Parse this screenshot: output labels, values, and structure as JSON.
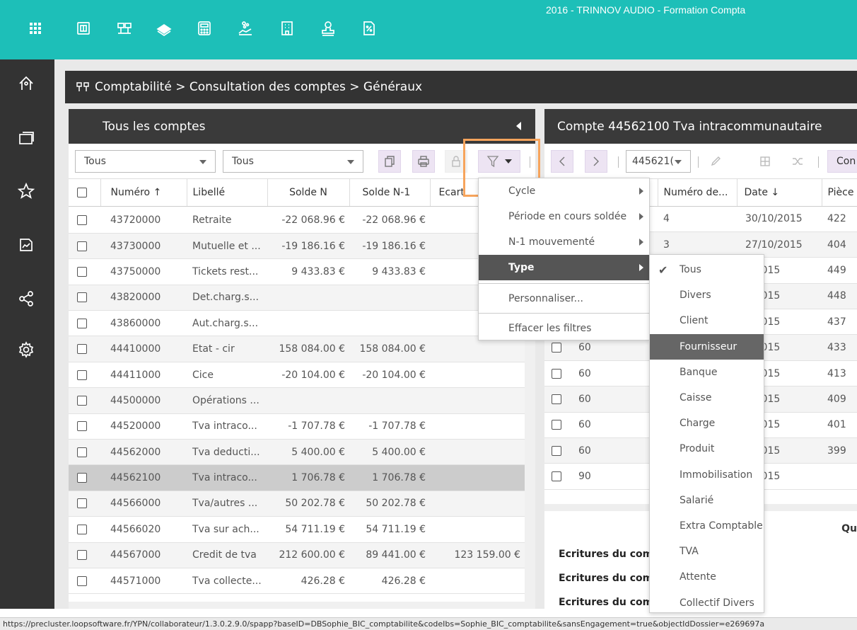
{
  "app": {
    "title": "2016 - TRINNOV AUDIO - Formation Compta"
  },
  "topbar_icons": [
    "apps-grid-icon",
    "dossier-icon",
    "accounting-icon",
    "banknotes-icon",
    "calculator-icon",
    "payroll-icon",
    "building-icon",
    "user-stamp-icon",
    "percent-document-icon"
  ],
  "leftnav_icons": [
    "home-icon",
    "screens-icon",
    "star-icon",
    "chart-document-icon",
    "share-icon",
    "settings-icon"
  ],
  "breadcrumb": "Comptabilité > Consultation des comptes > Généraux",
  "left_panel": {
    "title": "Tous les comptes",
    "filter1": "Tous",
    "filter2": "Tous",
    "columns": [
      "Numéro",
      "Libellé",
      "Solde N",
      "Solde N-1",
      "Ecart"
    ],
    "sort_glyph": "↑",
    "rows": [
      {
        "num": "43720000",
        "lib": "Retraite",
        "n": "-22 068.96 €",
        "n1": "-22 068.96 €",
        "ecart": ""
      },
      {
        "num": "43730000",
        "lib": "Mutuelle et ...",
        "n": "-19 186.16 €",
        "n1": "-19 186.16 €",
        "ecart": ""
      },
      {
        "num": "43750000",
        "lib": "Tickets rest...",
        "n": "9 433.83 €",
        "n1": "9 433.83 €",
        "ecart": ""
      },
      {
        "num": "43820000",
        "lib": "Det.charg.s...",
        "n": "",
        "n1": "",
        "ecart": ""
      },
      {
        "num": "43860000",
        "lib": "Aut.charg.s...",
        "n": "",
        "n1": "",
        "ecart": ""
      },
      {
        "num": "44410000",
        "lib": "Etat - cir",
        "n": "158 084.00 €",
        "n1": "158 084.00 €",
        "ecart": ""
      },
      {
        "num": "44411000",
        "lib": "Cice",
        "n": "-20 104.00 €",
        "n1": "-20 104.00 €",
        "ecart": ""
      },
      {
        "num": "44500000",
        "lib": "Opérations ...",
        "n": "",
        "n1": "",
        "ecart": ""
      },
      {
        "num": "44520000",
        "lib": "Tva intraco...",
        "n": "-1 707.78 €",
        "n1": "-1 707.78 €",
        "ecart": ""
      },
      {
        "num": "44562000",
        "lib": "Tva deducti...",
        "n": "5 400.00 €",
        "n1": "5 400.00 €",
        "ecart": ""
      },
      {
        "num": "44562100",
        "lib": "Tva intraco...",
        "n": "1 706.78 €",
        "n1": "1 706.78 €",
        "ecart": ""
      },
      {
        "num": "44566000",
        "lib": "Tva/autres ...",
        "n": "50 202.78 €",
        "n1": "50 202.78 €",
        "ecart": ""
      },
      {
        "num": "44566020",
        "lib": "Tva sur ach...",
        "n": "54 711.19 €",
        "n1": "54 711.19 €",
        "ecart": ""
      },
      {
        "num": "44567000",
        "lib": "Credit de tva",
        "n": "212 600.00 €",
        "n1": "89 441.00 €",
        "ecart": "123 159.00 €"
      },
      {
        "num": "44571000",
        "lib": "Tva collecte...",
        "n": "426.28 €",
        "n1": "426.28 €",
        "ecart": ""
      }
    ]
  },
  "right_panel": {
    "title": "Compte 44562100 Tva intracommunautaire",
    "account_select": "445621(",
    "action_label": "Con",
    "columns": [
      "Numéro de...",
      "Date",
      "Pièce"
    ],
    "date_sort_glyph": "↓",
    "rows": [
      {
        "jnl": "",
        "num": "4",
        "date": "30/10/2015",
        "piece": "422"
      },
      {
        "jnl": "",
        "num": "3",
        "date": "27/10/2015",
        "piece": "404"
      },
      {
        "jnl": "",
        "num": "",
        "date": "0/2015",
        "piece": "449"
      },
      {
        "jnl": "",
        "num": "",
        "date": "0/2015",
        "piece": "448"
      },
      {
        "jnl": "",
        "num": "",
        "date": "0/2015",
        "piece": "437"
      },
      {
        "jnl": "60",
        "num": "",
        "date": "0/2015",
        "piece": "433"
      },
      {
        "jnl": "60",
        "num": "",
        "date": "0/2015",
        "piece": "413"
      },
      {
        "jnl": "60",
        "num": "",
        "date": "0/2015",
        "piece": "409"
      },
      {
        "jnl": "60",
        "num": "",
        "date": "0/2015",
        "piece": "401"
      },
      {
        "jnl": "60",
        "num": "",
        "date": "0/2015",
        "piece": "399"
      },
      {
        "jnl": "90",
        "num": "",
        "date": "9/2015",
        "piece": ""
      }
    ],
    "summary": {
      "qu": "Qu",
      "lines": [
        "Ecritures du com",
        "Ecritures du com",
        "Ecritures du com"
      ]
    }
  },
  "filter_menu": {
    "items": [
      "Cycle",
      "Période en cours soldée",
      "N-1 mouvementé",
      "Type"
    ],
    "customize": "Personnaliser...",
    "clear": "Effacer les filtres"
  },
  "type_menu": {
    "checked": "✔",
    "items": [
      "Tous",
      "Divers",
      "Client",
      "Fournisseur",
      "Banque",
      "Caisse",
      "Charge",
      "Produit",
      "Immobilisation",
      "Salarié",
      "Extra Comptable",
      "TVA",
      "Attente",
      "Collectif Divers"
    ]
  },
  "status_url": "https://precluster.loopsoftware.fr/YPN/collaborateur/1.3.0.2.9.0/spapp?baseID=DBSophie_BIC_comptabilite&codeIbs=Sophie_BIC_comptabilite&sansEngagement=true&objectIdDossier=e269697a",
  "colors": {
    "accent": "#1dbfb8",
    "dark": "#333333",
    "highlight": "#f7a45c",
    "button_bg": "#ede4f3"
  }
}
